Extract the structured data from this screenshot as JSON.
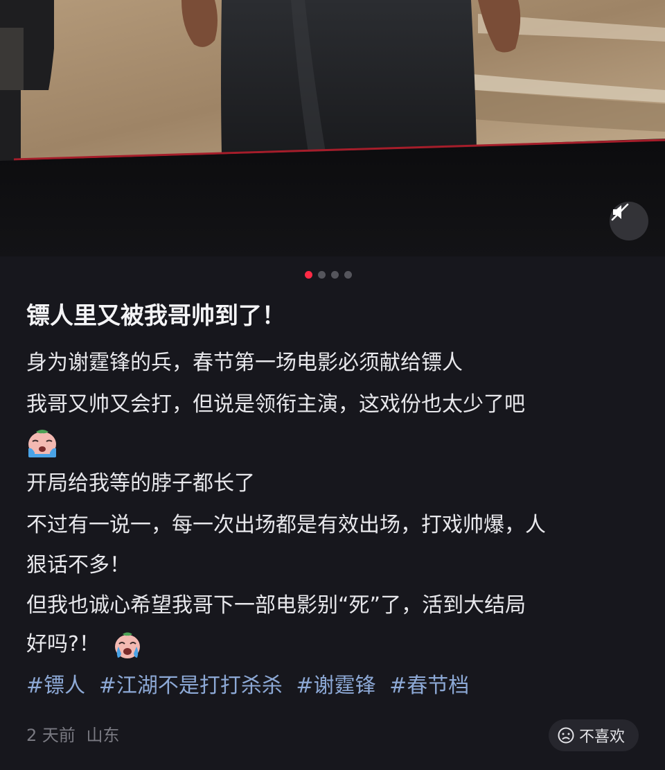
{
  "media": {
    "carousel_total": 4,
    "carousel_active_index": 0,
    "mute_icon": "speaker-muted-icon"
  },
  "post": {
    "title": "镖人里又被我哥帅到了！",
    "lines": [
      "身为谢霆锋的兵，春节第一场电影必须献给镖人",
      "我哥又帅又会打，但说是领衔主演，这戏份也太少了吧",
      "开局给我等的脖子都长了",
      "不过有一说一，每一次出场都是有效出场，打戏帅爆，人",
      "狠话不多！",
      "但我也诚心希望我哥下一部电影别“死”了，活到大结局",
      "好吗?！"
    ],
    "emojis": [
      "crying-face-emoji",
      "crying-face-emoji"
    ],
    "tags": [
      "#镖人",
      "#江湖不是打打杀杀",
      "#谢霆锋",
      "#春节档"
    ]
  },
  "footer": {
    "time": "2 天前",
    "location": "山东",
    "dislike_label": "不喜欢",
    "dislike_icon": "frown-face-icon"
  },
  "colors": {
    "background": "#17171d",
    "accent_dot": "#ff2a45",
    "tag": "#8da9d6",
    "meta_text": "#7a7a82"
  }
}
